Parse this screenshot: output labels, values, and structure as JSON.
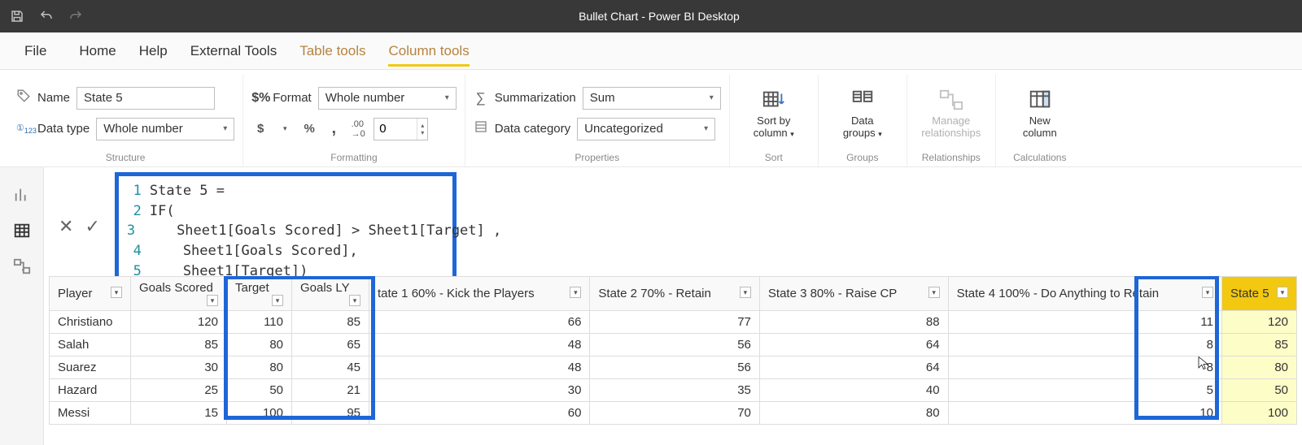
{
  "titlebar": {
    "title": "Bullet Chart - Power BI Desktop"
  },
  "tabs": {
    "file": "File",
    "home": "Home",
    "help": "Help",
    "ext": "External Tools",
    "table": "Table tools",
    "col": "Column tools"
  },
  "structure": {
    "group": "Structure",
    "name_label": "Name",
    "name_value": "State 5",
    "dtype_label": "Data type",
    "dtype_value": "Whole number"
  },
  "formatting": {
    "group": "Formatting",
    "format_label": "Format",
    "format_value": "Whole number",
    "decimals": "0"
  },
  "properties": {
    "group": "Properties",
    "sum_label": "Summarization",
    "sum_value": "Sum",
    "cat_label": "Data category",
    "cat_value": "Uncategorized"
  },
  "sort": {
    "group": "Sort",
    "btn1_l1": "Sort by",
    "btn1_l2": "column"
  },
  "groups": {
    "group": "Groups",
    "btn_l1": "Data",
    "btn_l2": "groups"
  },
  "rel": {
    "group": "Relationships",
    "btn_l1": "Manage",
    "btn_l2": "relationships"
  },
  "calc": {
    "group": "Calculations",
    "btn_l1": "New",
    "btn_l2": "column"
  },
  "formula": {
    "l1": "State 5 =",
    "l2": "IF(",
    "l3": "    Sheet1[Goals Scored] > Sheet1[Target] ,",
    "l4": "    Sheet1[Goals Scored],",
    "l5": "    Sheet1[Target])"
  },
  "grid": {
    "headers": [
      "Player",
      "Goals Scored",
      "Target",
      "Goals LY",
      "tate 1 60% - Kick the Players",
      "State 2 70% - Retain",
      "State 3 80% - Raise CP",
      "State 4 100% - Do Anything to Retain",
      "State 5"
    ],
    "rows": [
      [
        "Christiano",
        "120",
        "110",
        "85",
        "66",
        "77",
        "88",
        "11",
        "120"
      ],
      [
        "Salah",
        "85",
        "80",
        "65",
        "48",
        "56",
        "64",
        "8",
        "85"
      ],
      [
        "Suarez",
        "30",
        "80",
        "45",
        "48",
        "56",
        "64",
        "8",
        "80"
      ],
      [
        "Hazard",
        "25",
        "50",
        "21",
        "30",
        "35",
        "40",
        "5",
        "50"
      ],
      [
        "Messi",
        "15",
        "100",
        "95",
        "60",
        "70",
        "80",
        "10",
        "100"
      ]
    ]
  }
}
